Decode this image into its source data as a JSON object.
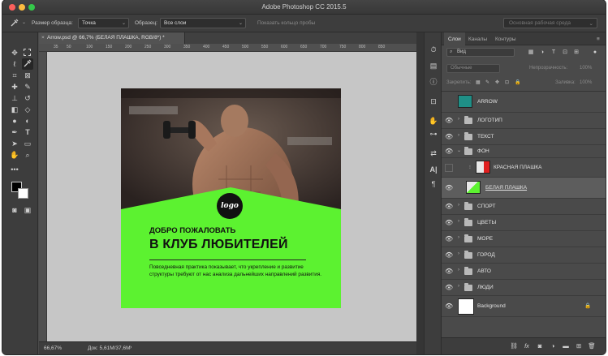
{
  "window": {
    "title": "Adobe Photoshop CC 2015.5"
  },
  "options_bar": {
    "sample_size_label": "Размер образца:",
    "sample_size_value": "Точка",
    "sample_label": "Образец:",
    "sample_value": "Все слои",
    "show_ring_label": "Показать кольцо пробы",
    "workspace": "Основная рабочая среда"
  },
  "document": {
    "tab_title": "Arrow.psd @ 66,7% (БЕЛАЯ ПЛАШКА, RGB/8*) *",
    "zoom": "66,67%",
    "doc_info": "Док: 5,61M/37,6M",
    "ruler_numbers": [
      "35",
      "50",
      "100",
      "150",
      "200",
      "250",
      "300",
      "350",
      "400",
      "450",
      "500",
      "550",
      "600",
      "650",
      "700",
      "750",
      "800",
      "850"
    ]
  },
  "artwork": {
    "logo_text": "logo",
    "heading_small": "ДОБРО ПОЖАЛОВАТЬ",
    "heading_big": "В КЛУБ ЛЮБИТЕЛЕЙ",
    "body": "Повседневная практика показывает, что укрепление и развитие структуры требуют от нас анализа дальнейших направлений развития.",
    "colors": {
      "green": "#5cf230",
      "dark": "#111111"
    }
  },
  "layers_panel": {
    "tabs": [
      "Слои",
      "Каналы",
      "Контуры"
    ],
    "filter_label": "Вид",
    "blend_mode": "Обычные",
    "opacity_label": "Непрозрачность:",
    "opacity_value": "100%",
    "lock_label": "Закрепить:",
    "fill_label": "Заливка:",
    "fill_value": "100%",
    "layers": [
      {
        "name": "ARROW",
        "visible": false,
        "type": "smart",
        "selected": false
      },
      {
        "name": "ЛОГОТИП",
        "visible": true,
        "type": "group",
        "selected": false
      },
      {
        "name": "ТЕКСТ",
        "visible": true,
        "type": "group",
        "selected": false
      },
      {
        "name": "ФОН",
        "visible": true,
        "type": "group-open",
        "selected": false
      },
      {
        "name": "КРАСНАЯ ПЛАШКА",
        "visible": false,
        "type": "layer-red",
        "selected": false
      },
      {
        "name": "БЕЛАЯ ПЛАШКА",
        "visible": true,
        "type": "layer-green",
        "selected": true
      },
      {
        "name": "СПОРТ",
        "visible": true,
        "type": "group",
        "selected": false
      },
      {
        "name": "ЦВЕТЫ",
        "visible": true,
        "type": "group",
        "selected": false
      },
      {
        "name": "МОРЕ",
        "visible": true,
        "type": "group",
        "selected": false
      },
      {
        "name": "ГОРОД",
        "visible": true,
        "type": "group",
        "selected": false
      },
      {
        "name": "АВТО",
        "visible": true,
        "type": "group",
        "selected": false
      },
      {
        "name": "ЛЮДИ",
        "visible": true,
        "type": "group",
        "selected": false
      },
      {
        "name": "Background",
        "visible": true,
        "type": "background",
        "selected": false
      }
    ]
  },
  "icons": {
    "traffic_colors": [
      "#fc605c",
      "#fdbc40",
      "#34c84a"
    ]
  }
}
